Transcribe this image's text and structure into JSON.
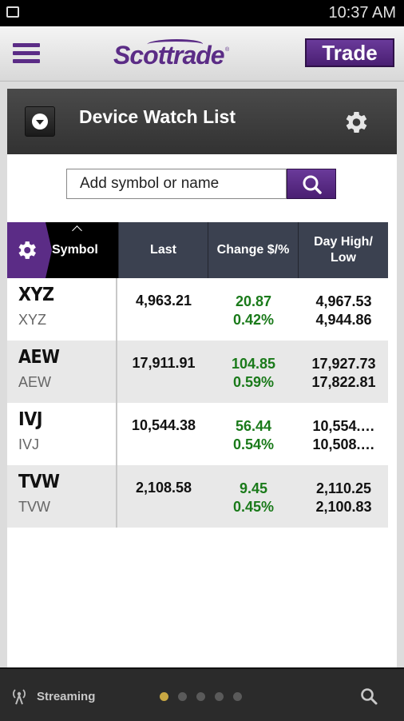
{
  "status_bar": {
    "time": "10:37 AM"
  },
  "header": {
    "logo": "Scottrade",
    "logo_mark": "®",
    "trade_label": "Trade"
  },
  "watchlist": {
    "title": "Device Watch List",
    "search_placeholder": "Add symbol or name",
    "columns": {
      "symbol": "Symbol",
      "last": "Last",
      "change": "Change $/%",
      "day_high_low": "Day High/ Low"
    },
    "rows": [
      {
        "symbol": "XYZ",
        "sub": "XYZ",
        "last": "4,963.21",
        "change": "20.87",
        "change_pct": "0.42%",
        "high": "4,967.53",
        "low": "4,944.86"
      },
      {
        "symbol": "AEW",
        "sub": "AEW",
        "last": "17,911.91",
        "change": "104.85",
        "change_pct": "0.59%",
        "high": "17,927.73",
        "low": "17,822.81"
      },
      {
        "symbol": "IVJ",
        "sub": "IVJ",
        "last": "10,544.38",
        "change": "56.44",
        "change_pct": "0.54%",
        "high": "10,554.…",
        "low": "10,508.…"
      },
      {
        "symbol": "TVW",
        "sub": "TVW",
        "last": "2,108.58",
        "change": "9.45",
        "change_pct": "0.45%",
        "high": "2,110.25",
        "low": "2,100.83"
      }
    ]
  },
  "bottom_bar": {
    "streaming_label": "Streaming",
    "page_count": 5,
    "active_page": 1
  },
  "colors": {
    "brand_purple": "#5b2c86",
    "positive_green": "#1a7a1a",
    "header_dark": "#3b4150",
    "active_dot": "#c9a843"
  }
}
